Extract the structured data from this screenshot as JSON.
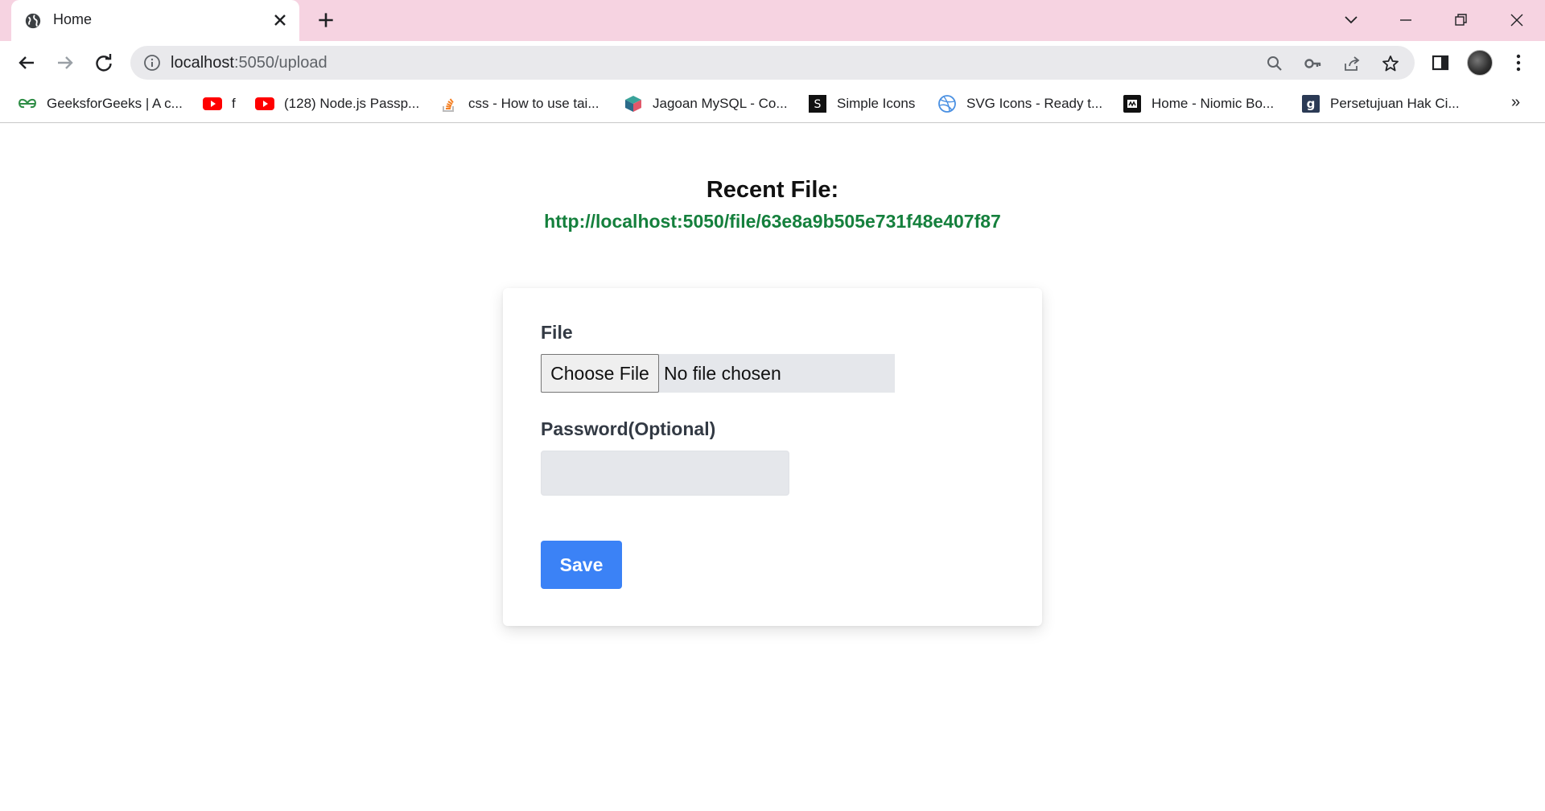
{
  "browser": {
    "tab": {
      "title": "Home"
    },
    "url": {
      "host": "localhost",
      "path": ":5050/upload"
    },
    "bookmarks": [
      {
        "label": "GeeksforGeeks | A c...",
        "icon": "gfg-icon"
      },
      {
        "label": "f",
        "icon": "youtube-icon"
      },
      {
        "label": "(128) Node.js Passp...",
        "icon": "youtube-icon"
      },
      {
        "label": "css - How to use tai...",
        "icon": "stackoverflow-icon"
      },
      {
        "label": "Jagoan MySQL - Co...",
        "icon": "cube-icon"
      },
      {
        "label": "Simple Icons",
        "icon": "simpleicons-icon"
      },
      {
        "label": "SVG Icons - Ready t...",
        "icon": "dribbble-icon"
      },
      {
        "label": "Home - Niomic Bo...",
        "icon": "niomic-icon"
      },
      {
        "label": "Persetujuan Hak Ci...",
        "icon": "g-icon"
      }
    ],
    "bookmarks_more": "»"
  },
  "page": {
    "recent_title": "Recent File:",
    "recent_link": "http://localhost:5050/file/63e8a9b505e731f48e407f87",
    "form": {
      "file_label": "File",
      "choose_file": "Choose File",
      "no_file": "No file chosen",
      "password_label": "Password(Optional)",
      "password_value": "",
      "save_label": "Save"
    }
  },
  "colors": {
    "tabstrip": "#f6d3e1",
    "link": "#15803d",
    "save_button": "#3b82f6"
  }
}
